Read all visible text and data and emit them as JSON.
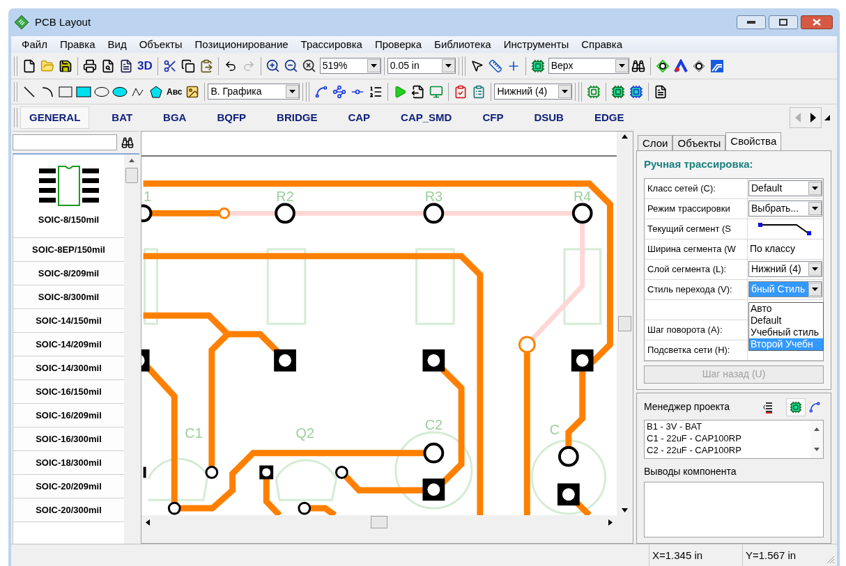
{
  "window": {
    "title": "PCB Layout"
  },
  "menu": [
    "Файл",
    "Правка",
    "Вид",
    "Объекты",
    "Позиционирование",
    "Трассировка",
    "Проверка",
    "Библиотека",
    "Инструменты",
    "Справка"
  ],
  "toolbar_main": {
    "label_3d": "3D",
    "zoom": "519%",
    "grid": "0.05 in",
    "layer": "Верх"
  },
  "toolbar_draw": {
    "text_tool": "Авс",
    "graphics_layer": "В. Графика",
    "route_layer": "Нижний (4)"
  },
  "library_tabs": [
    {
      "label": "GENERAL",
      "selected": true
    },
    {
      "label": "BAT",
      "selected": false
    },
    {
      "label": "BGA",
      "selected": false
    },
    {
      "label": "BQFP",
      "selected": false
    },
    {
      "label": "BRIDGE",
      "selected": false
    },
    {
      "label": "CAP",
      "selected": false
    },
    {
      "label": "CAP_SMD",
      "selected": false
    },
    {
      "label": "CFP",
      "selected": false
    },
    {
      "label": "DSUB",
      "selected": false
    },
    {
      "label": "EDGE",
      "selected": false
    }
  ],
  "library": {
    "items": [
      {
        "label": "SOIC-8/150mil",
        "selected": true
      },
      {
        "label": "SOIC-8EP/150mil",
        "selected": false
      },
      {
        "label": "SOIC-8/209mil",
        "selected": false
      },
      {
        "label": "SOIC-8/300mil",
        "selected": false
      },
      {
        "label": "SOIC-14/150mil",
        "selected": false
      },
      {
        "label": "SOIC-14/209mil",
        "selected": false
      },
      {
        "label": "SOIC-14/300mil",
        "selected": false
      },
      {
        "label": "SOIC-16/150mil",
        "selected": false
      },
      {
        "label": "SOIC-16/209mil",
        "selected": false
      },
      {
        "label": "SOIC-16/300mil",
        "selected": false
      },
      {
        "label": "SOIC-18/300mil",
        "selected": false
      },
      {
        "label": "SOIC-20/209mil",
        "selected": false
      },
      {
        "label": "SOIC-20/300mil",
        "selected": false
      }
    ]
  },
  "canvas": {
    "component_labels": [
      "1",
      "R2",
      "R3",
      "R4",
      "C1",
      "Q2",
      "C2",
      "C"
    ]
  },
  "properties_panel": {
    "tabs": [
      {
        "label": "Слои",
        "selected": false
      },
      {
        "label": "Объекты",
        "selected": false
      },
      {
        "label": "Свойства",
        "selected": true
      }
    ],
    "title": "Ручная трассировка:",
    "rows": [
      {
        "label": "Класс сетей (C):",
        "kind": "combo",
        "value": "Default",
        "highlighted": false
      },
      {
        "label": "Режим трассировки",
        "kind": "combo",
        "value": "Выбрать...",
        "highlighted": false
      },
      {
        "label": "Текущий сегмент (S",
        "kind": "segment"
      },
      {
        "label": "Ширина сегмента (W",
        "kind": "text",
        "value": "По классу"
      },
      {
        "label": "Слой сегмента (L):",
        "kind": "combo",
        "value": "Нижний (4)",
        "highlighted": false
      },
      {
        "label": "Стиль перехода (V):",
        "kind": "combo",
        "value": "бный Стиль",
        "highlighted": true
      },
      {
        "kind": "empty"
      },
      {
        "label": "Шаг поворота (A):",
        "kind": "empty"
      },
      {
        "label": "Подсветка сети (H):",
        "kind": "empty"
      }
    ],
    "dropdown": {
      "options": [
        {
          "label": "Авто",
          "selected": false
        },
        {
          "label": "Default",
          "selected": false
        },
        {
          "label": "Учебный стиль",
          "selected": false
        },
        {
          "label": "Второй Учебн",
          "selected": true
        }
      ]
    },
    "undo_button": {
      "label": "Шаг назад (U)",
      "disabled": true
    }
  },
  "project_manager": {
    "title": "Менеджер проекта",
    "items": [
      "B1 - 3V - BAT",
      "C1 - 22uF - CAP100RP",
      "C2 - 22uF - CAP100RP"
    ],
    "pins_title": "Выводы компонента"
  },
  "status_bar": {
    "x": "X=1.345 in",
    "y": "Y=1.567 in"
  }
}
